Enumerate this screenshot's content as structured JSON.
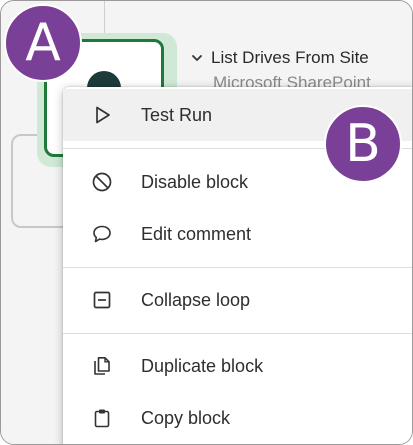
{
  "flow": {
    "block_title": "List Drives From Site",
    "block_subtitle": "Microsoft SharePoint",
    "colors": {
      "accent": "#1f7a3a",
      "glow": "#cfe9d6",
      "badge": "#7a3f96"
    }
  },
  "menu": {
    "items": [
      {
        "label": "Test Run",
        "icon": "play-icon"
      },
      {
        "label": "Disable block",
        "icon": "disable-icon"
      },
      {
        "label": "Edit comment",
        "icon": "comment-icon"
      },
      {
        "label": "Collapse loop",
        "icon": "collapse-icon"
      },
      {
        "label": "Duplicate block",
        "icon": "duplicate-icon"
      },
      {
        "label": "Copy block",
        "icon": "clipboard-icon"
      }
    ]
  },
  "badges": {
    "a": "A",
    "b": "B"
  }
}
